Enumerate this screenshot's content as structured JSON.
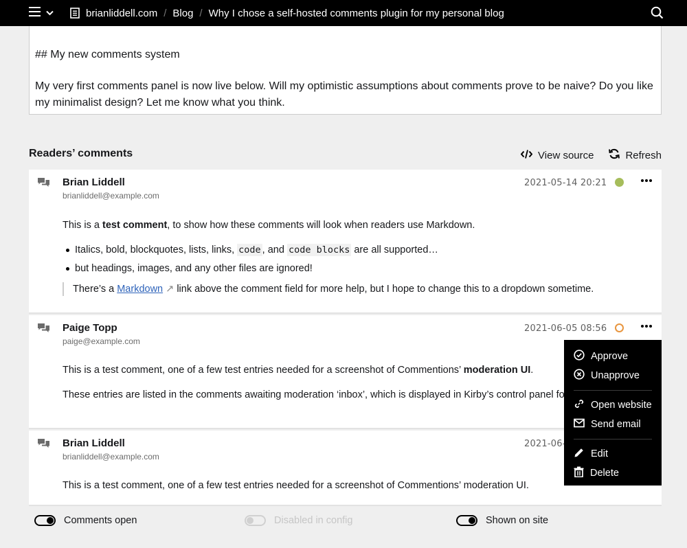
{
  "topbar": {
    "site": "brianliddell.com",
    "breadcrumbs": [
      "Blog",
      "Why I chose a self-hosted comments plugin for my personal blog"
    ]
  },
  "editor": {
    "heading_line": "## My new comments system",
    "body_line": "My very first comments panel is now live below. Will my optimistic assumptions about comments prove to be naive? Do you like my minimalist design? Let me know what you think."
  },
  "section": {
    "title": "Readers’ comments",
    "view_source": "View source",
    "refresh": "Refresh"
  },
  "comments": [
    {
      "author": "Brian Liddell",
      "email": "brianliddell@example.com",
      "date": "2021-05-14 20:21",
      "status_color": "#a6bd5b",
      "p1_a": "This is a ",
      "p1_strong": "test comment",
      "p1_b": ", to show how these comments will look when readers use Markdown.",
      "li1_a": "Italics, bold, blockquotes, lists, links, ",
      "li1_code1": "code",
      "li1_b": ", and ",
      "li1_code2": "code blocks",
      "li1_c": " are all supported…",
      "li2": "but headings, images, and any other files are ignored!",
      "bq_a": "There’s a ",
      "bq_link": "Markdown",
      "bq_arrow": "↗",
      "bq_b": " link above the comment field for more help, but I hope to change this to a dropdown sometime."
    },
    {
      "author": "Paige Topp",
      "email": "paige@example.com",
      "date": "2021-06-05 08:56",
      "status_color": "#e8953e",
      "p1_a": "This is a test comment, one of a few test entries needed for a screenshot of Commentions’ ",
      "p1_strong": "moderation UI",
      "p1_b": ".",
      "p2": "These entries are listed in the comments awaiting moderation ‘inbox’, which is displayed in Kirby’s control panel for my blog."
    },
    {
      "author": "Brian Liddell",
      "email": "brianliddell@example.com",
      "date": "2021-06-0",
      "p1": "This is a test comment, one of a few test entries needed for a screenshot of Commentions’ moderation UI."
    }
  ],
  "dropdown": {
    "approve": "Approve",
    "unapprove": "Unapprove",
    "open_website": "Open website",
    "send_email": "Send email",
    "edit": "Edit",
    "delete": "Delete"
  },
  "toggles": {
    "comments_open": "Comments open",
    "disabled_in_config": "Disabled in config",
    "shown_on_site": "Shown on site"
  }
}
